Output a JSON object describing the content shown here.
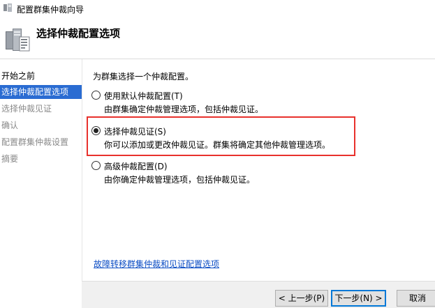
{
  "window": {
    "title": "配置群集仲裁向导"
  },
  "header": {
    "heading": "选择仲裁配置选项"
  },
  "nav": {
    "items": [
      {
        "label": "开始之前",
        "state": "done"
      },
      {
        "label": "选择仲裁配置选项",
        "state": "active"
      },
      {
        "label": "选择仲裁见证",
        "state": "pending"
      },
      {
        "label": "确认",
        "state": "pending"
      },
      {
        "label": "配置群集仲裁设置",
        "state": "pending"
      },
      {
        "label": "摘要",
        "state": "pending"
      }
    ]
  },
  "main": {
    "prompt": "为群集选择一个仲裁配置。",
    "options": [
      {
        "label": "使用默认仲裁配置(T)",
        "description": "由群集确定仲裁管理选项，包括仲裁见证。",
        "checked": false
      },
      {
        "label": "选择仲裁见证(S)",
        "description": "你可以添加或更改仲裁见证。群集将确定其他仲裁管理选项。",
        "checked": true
      },
      {
        "label": "高级仲裁配置(D)",
        "description": "由你确定仲裁管理选项，包括仲裁见证。",
        "checked": false
      }
    ],
    "link": "故障转移群集仲裁和见证配置选项"
  },
  "footer": {
    "prev_label": "< 上一步(P)",
    "next_label": "下一步(N) >",
    "cancel_label": "取消"
  },
  "colors": {
    "nav_active_bg": "#2a6cd2",
    "highlight_border": "#e8312c",
    "link": "#0b4cc4"
  }
}
